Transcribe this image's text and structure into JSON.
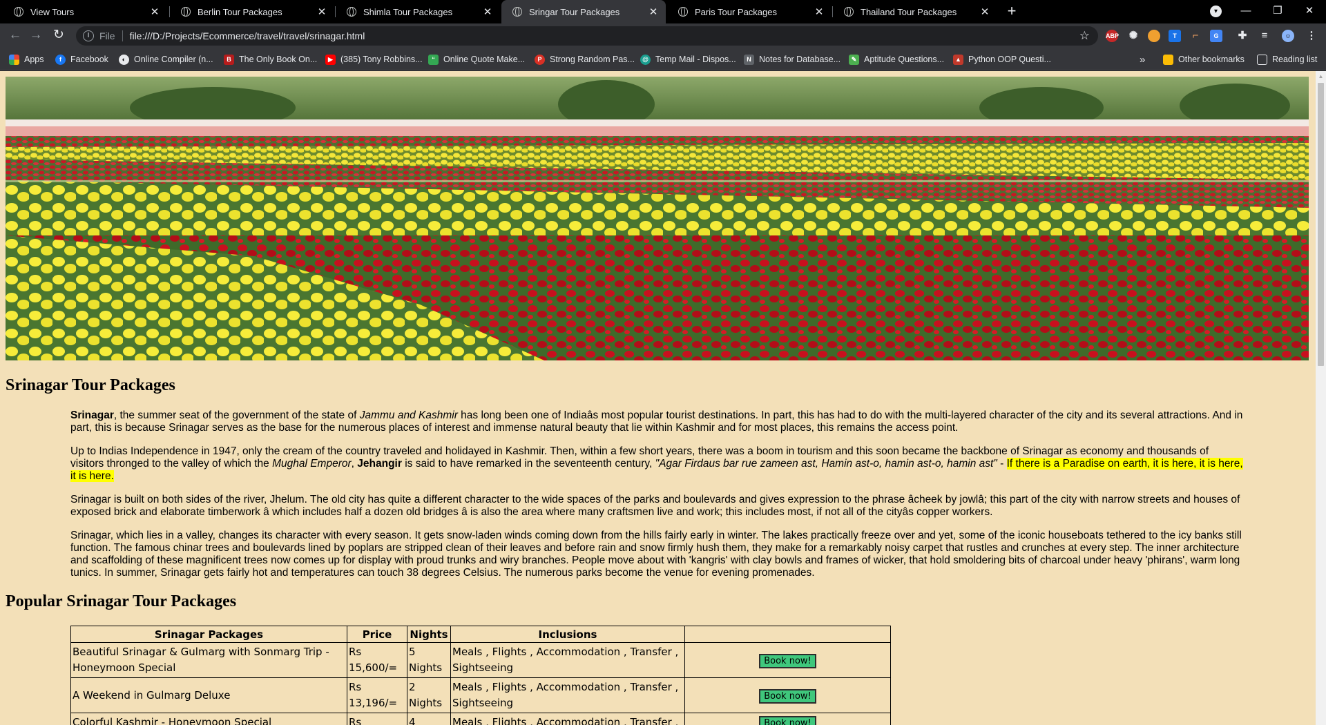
{
  "browser": {
    "tabs": [
      {
        "title": "View Tours",
        "active": false
      },
      {
        "title": "Berlin Tour Packages",
        "active": false
      },
      {
        "title": "Shimla Tour Packages",
        "active": false
      },
      {
        "title": "Sringar Tour Packages",
        "active": true
      },
      {
        "title": "Paris Tour Packages",
        "active": false
      },
      {
        "title": "Thailand Tour Packages",
        "active": false
      }
    ],
    "scheme_label": "File",
    "url": "file:///D:/Projects/Ecommerce/travel/travel/srinagar.html",
    "bookmarks": [
      {
        "label": "Apps",
        "icon": "apps-grid-icon",
        "color": "#ea4335"
      },
      {
        "label": "Facebook",
        "icon": "facebook-icon",
        "color": "#1877f2"
      },
      {
        "label": "Online Compiler (n...",
        "icon": "compiler-icon",
        "color": "#e8eaed"
      },
      {
        "label": "The Only Book On...",
        "icon": "book-icon",
        "color": "#b71c1c"
      },
      {
        "label": "(385) Tony Robbins...",
        "icon": "youtube-icon",
        "color": "#ff0000"
      },
      {
        "label": "Online Quote Make...",
        "icon": "quote-icon",
        "color": "#34a853"
      },
      {
        "label": "Strong Random Pas...",
        "icon": "password-icon",
        "color": "#d93025"
      },
      {
        "label": "Temp Mail - Dispos...",
        "icon": "mail-icon",
        "color": "#1a9e8f"
      },
      {
        "label": "Notes for Database...",
        "icon": "notes-icon",
        "color": "#5f6368"
      },
      {
        "label": "Aptitude Questions...",
        "icon": "aptitude-icon",
        "color": "#4caf50"
      },
      {
        "label": "Python OOP Questi...",
        "icon": "python-icon",
        "color": "#c0392b"
      }
    ],
    "other_bookmarks": "Other bookmarks",
    "reading_list": "Reading list"
  },
  "page": {
    "heading": "Srinagar Tour Packages",
    "p1": {
      "b1": "Srinagar",
      "t1": ", the summer seat of the government of the state of ",
      "i1": "Jammu and Kashmir",
      "t2": " has long been one of Indiaâs most popular tourist destinations. In part, this has had to do with the multi-layered character of the city and its several attractions. And in part, this is because Srinagar serves as the base for the numerous places of interest and immense natural beauty that lie within Kashmir and for most places, this remains the access point."
    },
    "p2": {
      "t1": "Up to Indias Independence in 1947, only the cream of the country traveled and holidayed in Kashmir. Then, within a few short years, there was a boom in tourism and this soon became the backbone of Srinagar as economy and thousands of visitors thronged to the valley of which the ",
      "i1": "Mughal Emperor",
      "t2": ", ",
      "b1": "Jehangir",
      "t3": " is said to have remarked in the seventeenth century, ",
      "i2": "\"Agar Firdaus bar rue zameen ast, Hamin ast-o, hamin ast-o, hamin ast\"",
      "t4": " - ",
      "highlight": "If there is a Paradise on earth, it is here, it is here, it is here."
    },
    "p3": "Srinagar is built on both sides of the river, Jhelum. The old city has quite a different character to the wide spaces of the parks and boulevards and gives expression to the phrase âcheek by jowlâ; this part of the city with narrow streets and houses of exposed brick and elaborate timberwork â which includes half a dozen old bridges â is also the area where many craftsmen live and work; this includes most, if not all of the cityâs copper workers.",
    "p4": "Srinagar, which lies in a valley, changes its character with every season. It gets snow-laden winds coming down from the hills fairly early in winter. The lakes practically freeze over and yet, some of the iconic houseboats tethered to the icy banks still function. The famous chinar trees and boulevards lined by poplars are stripped clean of their leaves and before rain and snow firmly hush them, they make for a remarkably noisy carpet that rustles and crunches at every step. The inner architecture and scaffolding of these magnificent trees now comes up for display with proud trunks and wiry branches. People move about with 'kangris' with clay bowls and frames of wicker, that hold smoldering bits of charcoal under heavy 'phirans', warm long tunics. In summer, Srinagar gets fairly hot and temperatures can touch 38 degrees Celsius. The numerous parks become the venue for evening promenades.",
    "popular_heading": "Popular Srinagar Tour Packages",
    "table": {
      "headers": [
        "Srinagar Packages",
        "Price",
        "Nights",
        "Inclusions",
        ""
      ],
      "rows": [
        {
          "name": "Beautiful Srinagar & Gulmarg with Sonmarg Trip - Honeymoon Special",
          "price": "Rs 15,600/=",
          "nights": "5 Nights",
          "inclusions": "Meals , Flights , Accommodation , Transfer , Sightseeing",
          "button": "Book now!"
        },
        {
          "name": "A Weekend in Gulmarg Deluxe",
          "price": "Rs 13,196/=",
          "nights": "2 Nights",
          "inclusions": "Meals , Flights , Accommodation , Transfer , Sightseeing",
          "button": "Book now!"
        },
        {
          "name": "Colorful Kashmir - Honeymoon Special",
          "price": "Rs",
          "nights": "4",
          "inclusions": "Meals , Flights , Accommodation , Transfer ,",
          "button": "Book now!"
        }
      ]
    }
  },
  "colors": {
    "page_bg": "#f3e0b8",
    "highlight": "#ffff00",
    "button_bg": "#3fc77c"
  }
}
